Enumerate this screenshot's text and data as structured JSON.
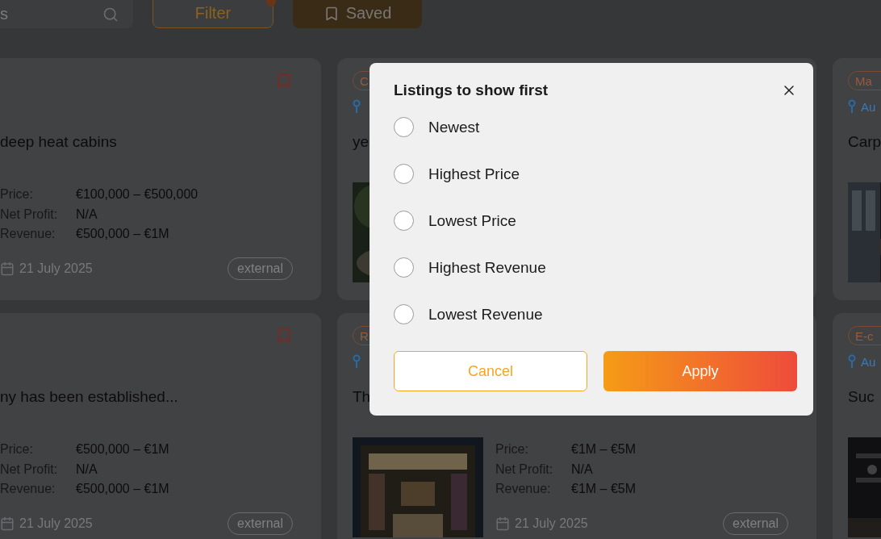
{
  "toolbar": {
    "search": {
      "value": "s"
    },
    "filter_button": {
      "label": "Filter",
      "badge": true
    },
    "saved_button": {
      "label": "Saved"
    }
  },
  "columns": [
    {
      "kind": "clipped",
      "cards": [
        {
          "saved": false,
          "title": "deep heat cabins",
          "details": [
            {
              "label": "Price:",
              "value": "€100,000 – €500,000"
            },
            {
              "label": "Net Profit:",
              "value": "N/A"
            },
            {
              "label": "Revenue:",
              "value": "€500,000 – €1M"
            }
          ],
          "date": "21 July 2025",
          "source": "external"
        },
        {
          "saved": false,
          "title": "ny has been established...",
          "details": [
            {
              "label": "Price:",
              "value": "€500,000 – €1M"
            },
            {
              "label": "Net Profit:",
              "value": "N/A"
            },
            {
              "label": "Revenue:",
              "value": "€500,000 – €1M"
            }
          ],
          "date": "21 July 2025",
          "source": "external"
        }
      ]
    },
    {
      "kind": "full",
      "cards": [
        {
          "tag": "C",
          "pin": true,
          "title": "ye"
        },
        {
          "tag": "R",
          "pin": true,
          "title": "Th",
          "details": [
            {
              "label": "Price:",
              "value": "€1M – €5M"
            },
            {
              "label": "Net Profit:",
              "value": "N/A"
            },
            {
              "label": "Revenue:",
              "value": "€1M – €5M"
            }
          ],
          "date": "21 July 2025",
          "source": "external"
        }
      ]
    },
    {
      "kind": "full",
      "cards": [
        {
          "tag": "Ma",
          "pin": true,
          "location": "Au",
          "title": "Carp"
        },
        {
          "tag": "E-c",
          "pin": true,
          "location": "Au",
          "title": "Suc"
        }
      ]
    }
  ],
  "dialog": {
    "title": "Listings to show first",
    "options": [
      {
        "label": "Newest",
        "selected": false
      },
      {
        "label": "Highest Price",
        "selected": false
      },
      {
        "label": "Lowest Price",
        "selected": false
      },
      {
        "label": "Highest Revenue",
        "selected": false
      },
      {
        "label": "Lowest Revenue",
        "selected": false
      }
    ],
    "cancel": "Cancel",
    "apply": "Apply"
  }
}
